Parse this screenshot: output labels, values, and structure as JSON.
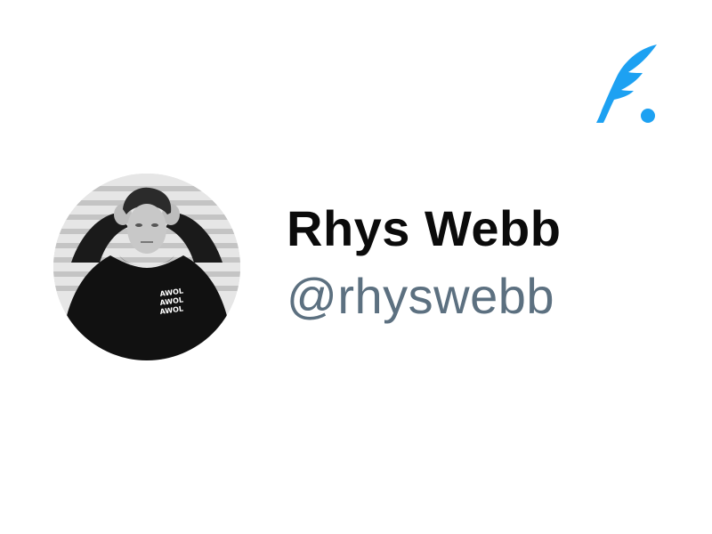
{
  "brand": {
    "icon": "feather-quill-icon",
    "color": "#1da1f2"
  },
  "profile": {
    "avatar": {
      "icon": "profile-photo-grayscale",
      "description_colors": [
        "#111111",
        "#cfcfcf"
      ]
    },
    "display_name": "Rhys Webb",
    "handle": "@rhyswebb"
  },
  "colors": {
    "name": "#0b0b0b",
    "handle": "#5c7080",
    "background": "#ffffff"
  }
}
